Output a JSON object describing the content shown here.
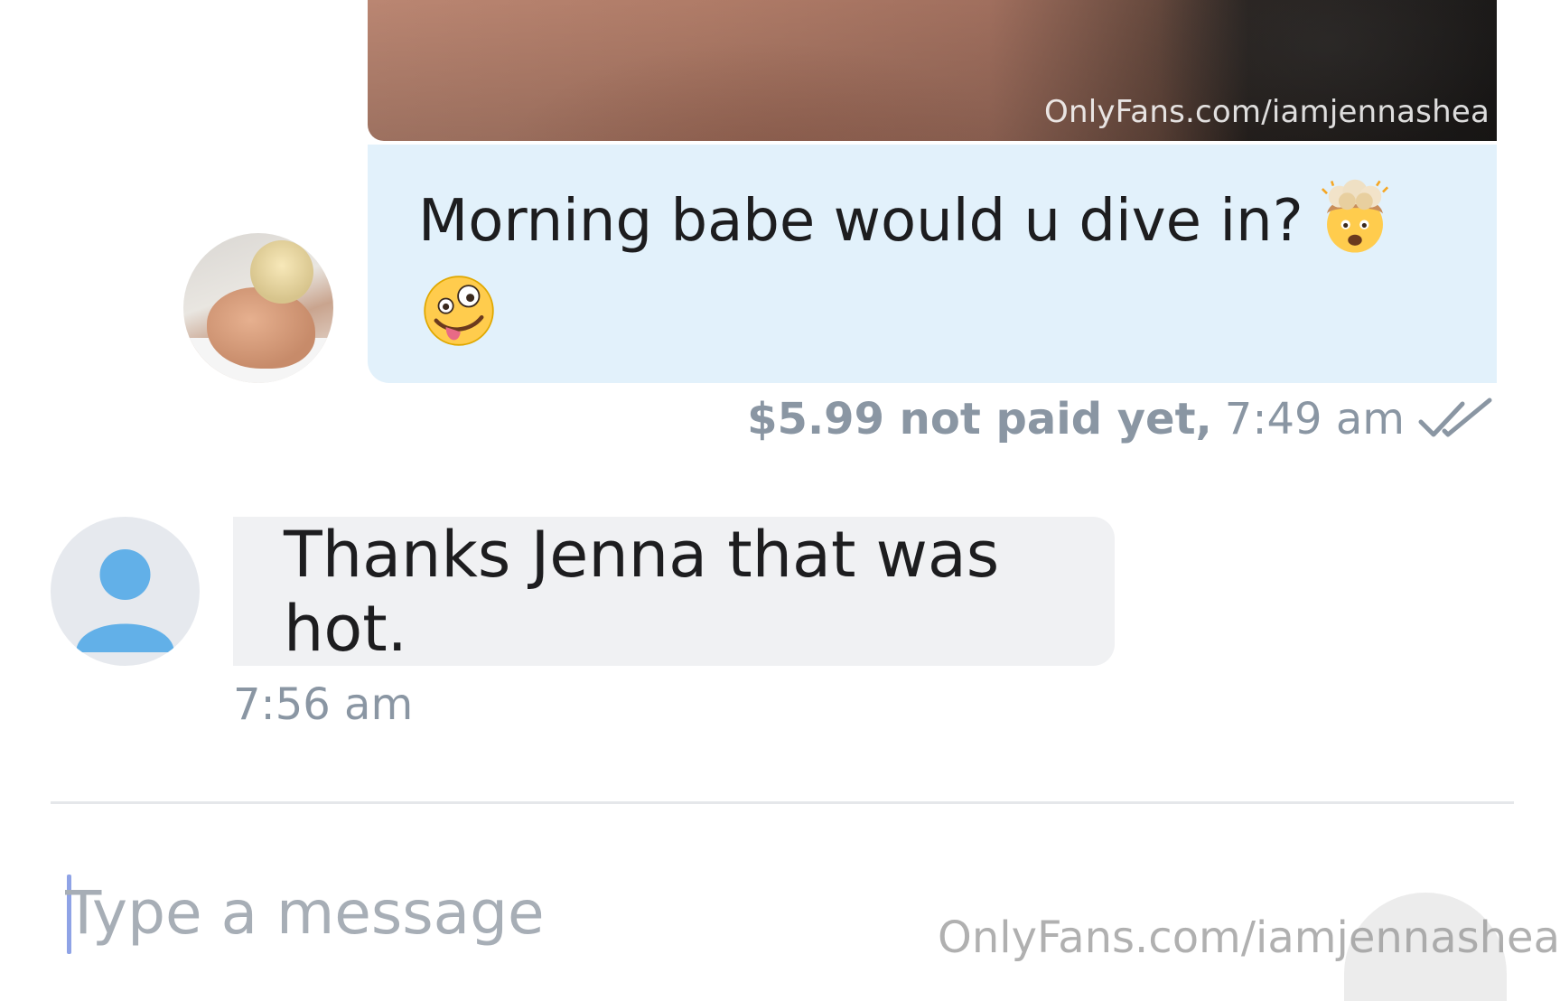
{
  "media": {
    "watermark": "OnlyFans.com/iamjennashea"
  },
  "outgoing_message": {
    "text": "Morning babe would u dive in?",
    "emojis": [
      "exploding-head",
      "zany-face"
    ],
    "price_status": "$5.99 not paid yet,",
    "time": "7:49 am",
    "read_status_icon": "double-check-icon"
  },
  "incoming_message": {
    "text": "Thanks Jenna that was hot.",
    "time": "7:56 am"
  },
  "compose": {
    "placeholder": "Type a message"
  },
  "footer_watermark": "OnlyFans.com/iamjennashea",
  "colors": {
    "outgoing_bubble": "#e2f1fb",
    "incoming_bubble": "#f0f1f3",
    "meta_text": "#8a96a3",
    "placeholder": "#a7aeb6",
    "caret": "#8fa3e6",
    "default_avatar": "#62b0e8"
  }
}
